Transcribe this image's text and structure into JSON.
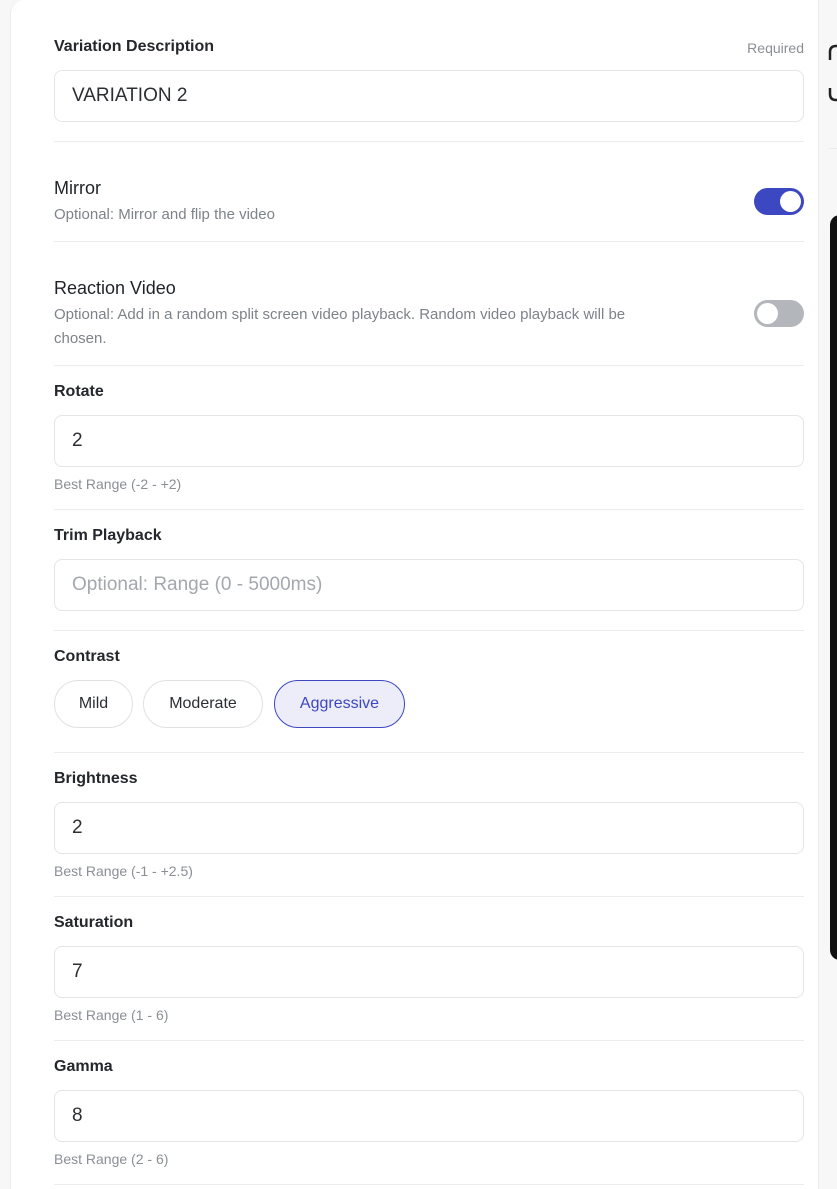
{
  "variation": {
    "label": "Variation Description",
    "required": "Required",
    "value": "VARIATION 2"
  },
  "mirror": {
    "title": "Mirror",
    "description": "Optional: Mirror and flip the video",
    "enabled": true
  },
  "reaction": {
    "title": "Reaction Video",
    "description": "Optional: Add in a random split screen video playback. Random video playback will be",
    "description_line2": "chosen.",
    "enabled": false
  },
  "rotate": {
    "label": "Rotate",
    "value": "2",
    "hint": "Best Range (-2 - +2)"
  },
  "trim": {
    "label": "Trim Playback",
    "placeholder": "Optional: Range (0 - 5000ms)"
  },
  "contrast": {
    "label": "Contrast",
    "options": [
      "Mild",
      "Moderate",
      "Aggressive"
    ],
    "selected": "Aggressive"
  },
  "brightness": {
    "label": "Brightness",
    "value": "2",
    "hint": "Best Range (-1 - +2.5)"
  },
  "saturation": {
    "label": "Saturation",
    "value": "7",
    "hint": "Best Range (1 - 6)"
  },
  "gamma": {
    "label": "Gamma",
    "value": "8",
    "hint": "Best Range (2 - 6)"
  },
  "colors": {
    "accent": "#3c47c2",
    "toggle_off": "#b3b6ba"
  }
}
